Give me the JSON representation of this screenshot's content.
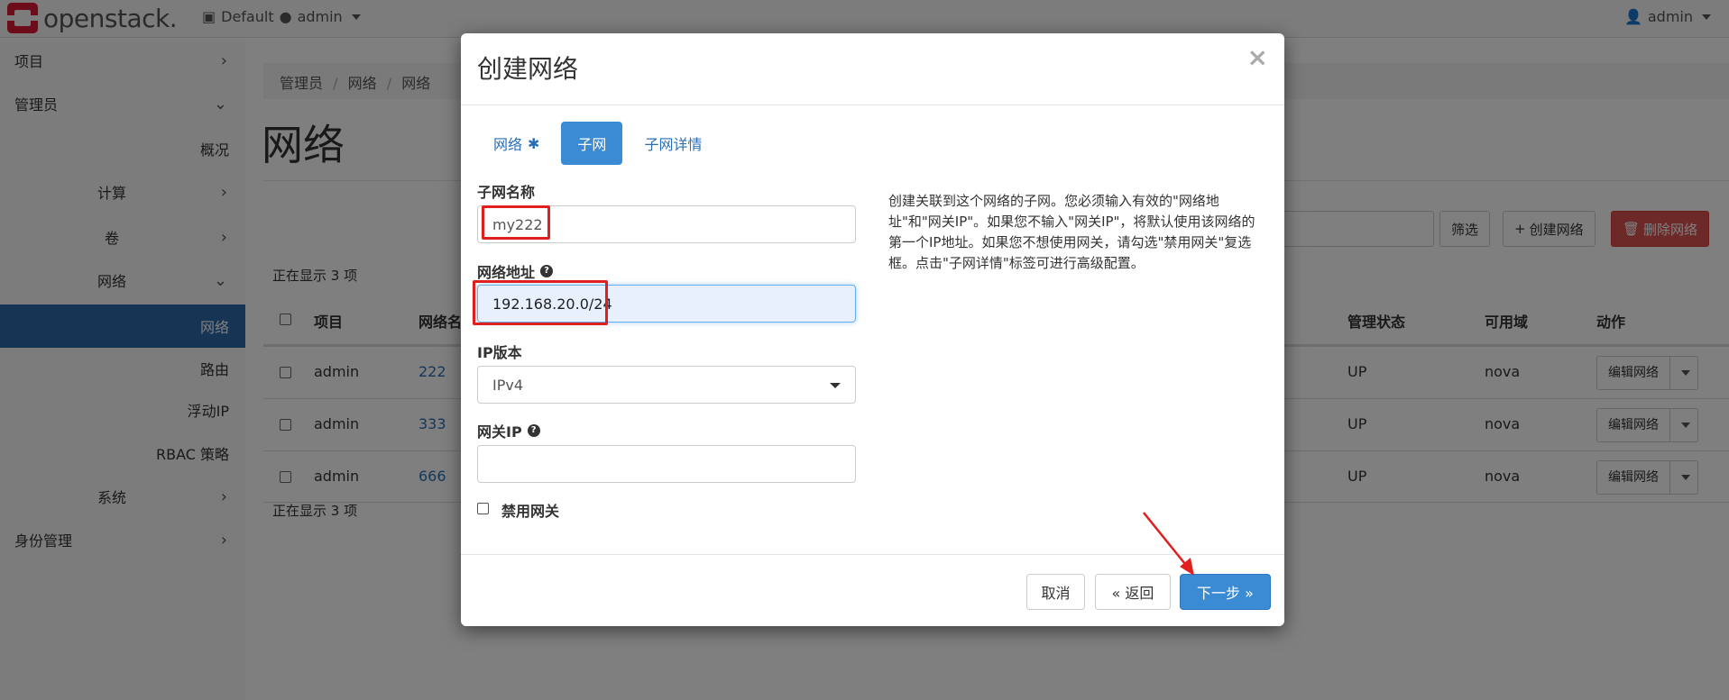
{
  "topbar": {
    "brand": "openstack.",
    "domain": "Default",
    "project": "admin",
    "user": "admin"
  },
  "sidebar": {
    "items": [
      {
        "label": "项目",
        "chevron": "chevron-right"
      },
      {
        "label": "管理员",
        "chevron": "chevron-down"
      },
      {
        "label": "概况"
      },
      {
        "label": "计算",
        "chevron": "chevron-right"
      },
      {
        "label": "卷",
        "chevron": "chevron-right"
      },
      {
        "label": "网络",
        "chevron": "chevron-down"
      },
      {
        "label": "网络",
        "active": true
      },
      {
        "label": "路由"
      },
      {
        "label": "浮动IP"
      },
      {
        "label": "RBAC 策略"
      },
      {
        "label": "系统",
        "chevron": "chevron-right"
      },
      {
        "label": "身份管理",
        "chevron": "chevron-right"
      }
    ]
  },
  "page": {
    "breadcrumb": [
      "管理员",
      "网络",
      "网络"
    ],
    "title": "网络",
    "filter_button": "筛选",
    "create_button": "创建网络",
    "delete_button": "删除网络",
    "count_top": "正在显示 3 项",
    "count_bottom": "正在显示 3 项"
  },
  "table": {
    "headers": {
      "project": "项目",
      "name": "网络名",
      "admin_state": "管理状态",
      "az": "可用域",
      "actions": "动作"
    },
    "rows": [
      {
        "project": "admin",
        "name": "222",
        "admin_state": "UP",
        "az": "nova",
        "action": "编辑网络"
      },
      {
        "project": "admin",
        "name": "333",
        "admin_state": "UP",
        "az": "nova",
        "action": "编辑网络"
      },
      {
        "project": "admin",
        "name": "666",
        "admin_state": "UP",
        "az": "nova",
        "action": "编辑网络"
      }
    ]
  },
  "modal": {
    "title": "创建网络",
    "close": "×",
    "tabs": [
      {
        "label": "网络",
        "required_marker": "✱"
      },
      {
        "label": "子网",
        "active": true
      },
      {
        "label": "子网详情"
      }
    ],
    "subnet_name": {
      "label": "子网名称",
      "value": "my222"
    },
    "network_address": {
      "label": "网络地址",
      "value": "192.168.20.0/24"
    },
    "ip_version": {
      "label": "IP版本",
      "value": "IPv4"
    },
    "gateway_ip": {
      "label": "网关IP",
      "value": ""
    },
    "disable_gateway": {
      "label": "禁用网关",
      "checked": false
    },
    "description": "创建关联到这个网络的子网。您必须输入有效的\"网络地址\"和\"网关IP\"。如果您不输入\"网关IP\"，将默认使用该网络的第一个IP地址。如果您不想使用网关，请勾选\"禁用网关\"复选框。点击\"子网详情\"标签可进行高级配置。",
    "buttons": {
      "cancel": "取消",
      "back": "« 返回",
      "next": "下一步 »"
    }
  },
  "colors": {
    "accent": "#3b8ad4",
    "active_nav": "#2c68a8",
    "annotation": "#e0201e"
  }
}
